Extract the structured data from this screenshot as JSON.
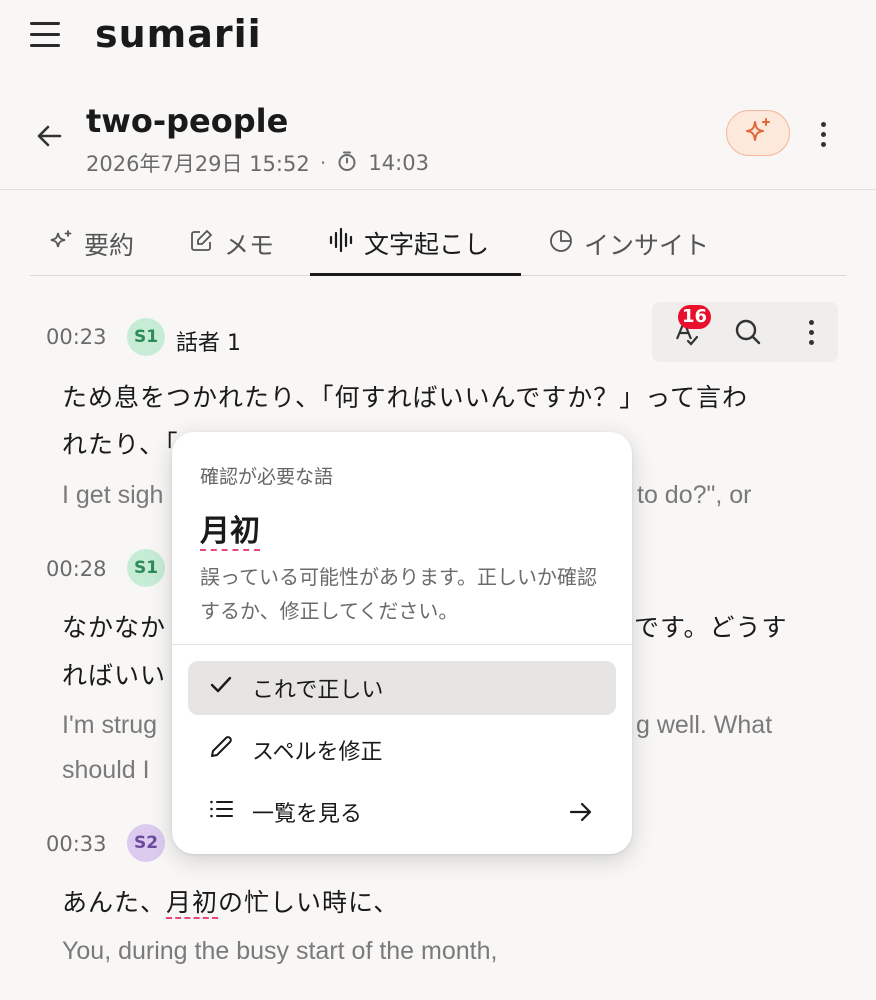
{
  "app": {
    "logo": "sumarii"
  },
  "recording": {
    "title": "two-people",
    "date": "2026年7月29日 15:52",
    "separator": "·",
    "duration": "14:03"
  },
  "tabs": [
    {
      "label": "要約",
      "icon": "sparkle-outline-icon"
    },
    {
      "label": "メモ",
      "icon": "note-edit-icon"
    },
    {
      "label": "文字起こし",
      "icon": "waveform-icon",
      "active": true
    },
    {
      "label": "インサイト",
      "icon": "pie-chart-icon"
    }
  ],
  "toolbar": {
    "badge_count": "16"
  },
  "segments": [
    {
      "time": "00:23",
      "avatar": "S1",
      "speaker": "話者 1",
      "ja_lines": [
        "ため息をつかれたり、「何すればいいんですか？」って言わ",
        "れたり、「"
      ],
      "en_visible_left": "I get sigh",
      "en_visible_right": "to do?\", or"
    },
    {
      "time": "00:28",
      "avatar": "S1",
      "ja_visible_left_1": "なかなか",
      "ja_visible_right_1": "です。どうす",
      "ja_visible_left_2": "ればいい",
      "en_visible_left_1": "I'm strug",
      "en_visible_right_1": "g well. What",
      "en_visible_left_2": "should I"
    },
    {
      "time": "00:33",
      "avatar": "S2",
      "ja_before": "あんた、",
      "ja_flagged": "月初",
      "ja_after": "の忙しい時に、",
      "en": "You, during the busy start of the month,"
    }
  ],
  "popover": {
    "label": "確認が必要な語",
    "word": "月初",
    "description": "誤っている可能性があります。正しいか確認するか、修正してください。",
    "actions": [
      {
        "label": "これで正しい",
        "icon": "check-icon"
      },
      {
        "label": "スペルを修正",
        "icon": "pencil-icon"
      },
      {
        "label": "一覧を見る",
        "icon": "list-icon"
      }
    ]
  },
  "colors": {
    "background": "#f8f7f5",
    "accent_ai": "#e0673a",
    "badge": "#e8102a",
    "flag_underline": "#e8467c",
    "speaker1": "#c7ecd6",
    "speaker2": "#dccbef"
  }
}
